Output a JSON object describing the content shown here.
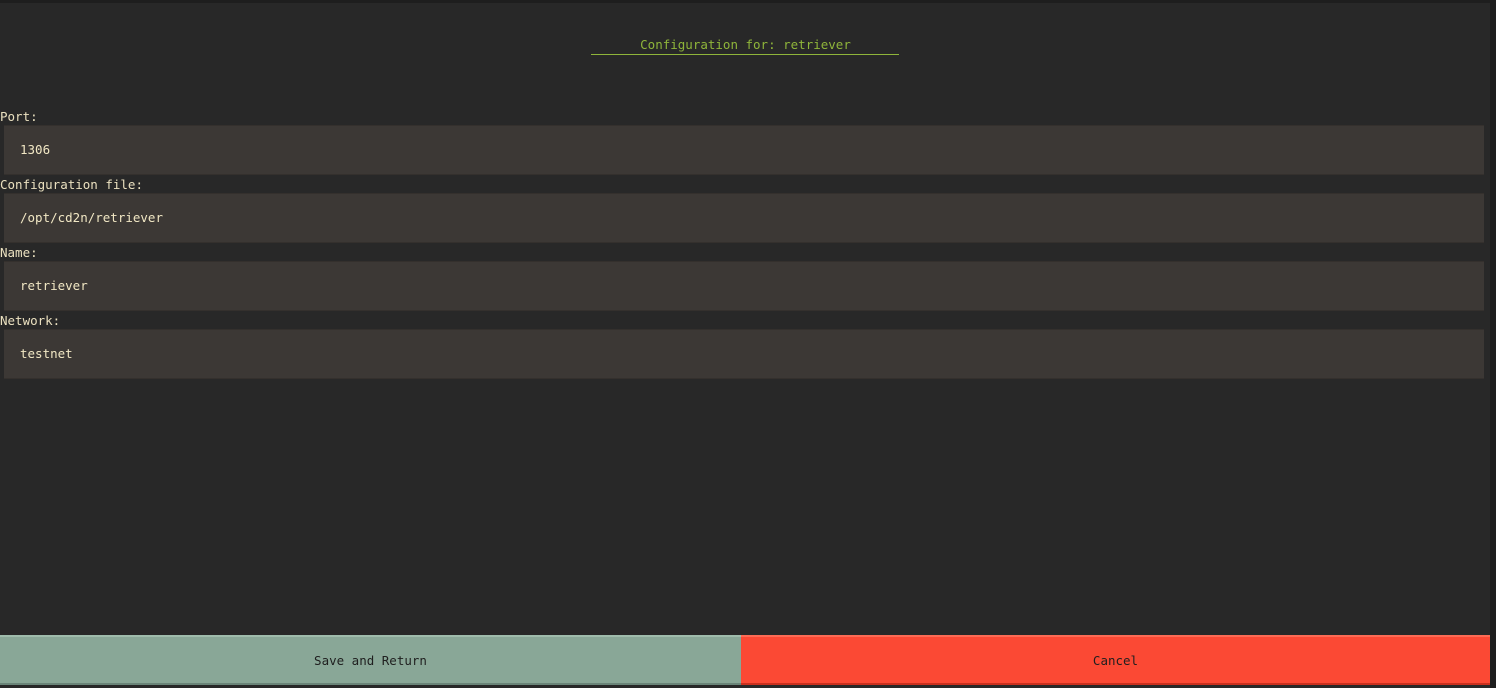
{
  "header": {
    "title": "Configuration for: retriever"
  },
  "form": {
    "fields": [
      {
        "label": "Port:",
        "value": "1306"
      },
      {
        "label": "Configuration file:",
        "value": "/opt/cd2n/retriever"
      },
      {
        "label": "Name:",
        "value": "retriever"
      },
      {
        "label": "Network:",
        "value": "testnet"
      }
    ]
  },
  "actions": {
    "save_label": "Save and Return",
    "cancel_label": "Cancel"
  },
  "colors": {
    "background": "#282828",
    "title_accent": "#8fb53a",
    "input_bg": "#3c3835",
    "label_text": "#ebe1c0",
    "save_bg": "#89a797",
    "cancel_bg": "#fb4934"
  }
}
